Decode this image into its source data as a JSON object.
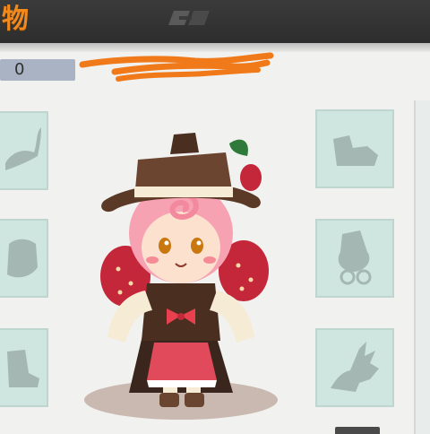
{
  "header": {
    "title": "物",
    "title_color": "#f08a1e"
  },
  "counter": {
    "value": "0"
  },
  "equipment_slots": {
    "left": [
      {
        "icon": "feather-hat-silhouette-icon"
      },
      {
        "icon": "armor-silhouette-icon"
      },
      {
        "icon": "boots-silhouette-icon"
      }
    ],
    "right": [
      {
        "icon": "boots-silhouette-icon"
      },
      {
        "icon": "hat-glasses-silhouette-icon"
      },
      {
        "icon": "dragon-head-silhouette-icon"
      }
    ]
  },
  "colors": {
    "header_bg": "#333333",
    "slot_bg": "#cfe5df",
    "redaction": "#f07a1a"
  }
}
